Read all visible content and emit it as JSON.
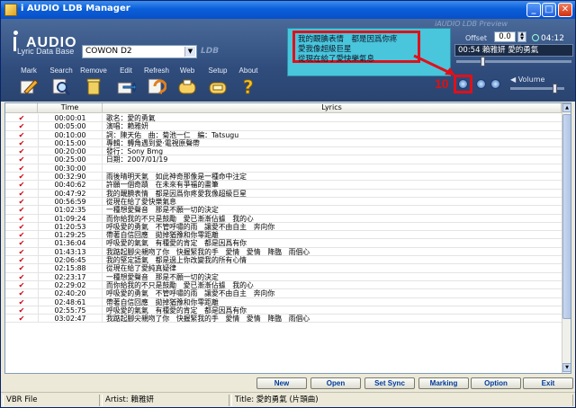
{
  "window": {
    "title": "i AUDIO LDB Manager"
  },
  "header": {
    "logo_text": "AUDIO",
    "db_label": "Lyric Data Base",
    "db_selected": "COWON D2",
    "db_tag": "LDB",
    "toolbar": [
      {
        "label": "Mark",
        "icon": "pencil-icon"
      },
      {
        "label": "Search",
        "icon": "search-icon"
      },
      {
        "label": "Remove",
        "icon": "trash-icon"
      },
      {
        "label": "Edit",
        "icon": "edit-icon"
      },
      {
        "label": "Refresh",
        "icon": "refresh-icon"
      },
      {
        "label": "Web",
        "icon": "web-icon"
      },
      {
        "label": "Setup",
        "icon": "setup-icon"
      },
      {
        "label": "About",
        "icon": "question-icon"
      }
    ]
  },
  "preview": {
    "title": "iAUDIO LDB Preview",
    "lines": [
      "我的靦腆表情　都是因爲你疼",
      "愛我像超級巨星",
      "從現在給了愛快樂氣息"
    ],
    "offset_label": "Offset",
    "offset_value": "0.0",
    "clock": "04:12",
    "position": "00:54",
    "now_title": "賴雅妍 愛的勇氣",
    "marker": "10",
    "volume_label": "Volume",
    "seek_fraction": 0.22,
    "volume_fraction": 0.85
  },
  "table": {
    "headers": {
      "mark": "",
      "time": "Time",
      "lyrics": "Lyrics"
    },
    "rows": [
      {
        "mark": "✔",
        "time": "00:00:01",
        "lyric": "歌名：愛的勇氣"
      },
      {
        "mark": "✔",
        "time": "00:05:00",
        "lyric": "演唱：賴雅妍"
      },
      {
        "mark": "✔",
        "time": "00:10:00",
        "lyric": "詞：陳天佑　曲：菊池一仁　編：Tatsugu"
      },
      {
        "mark": "✔",
        "time": "00:15:00",
        "lyric": "專輯：轉角遇到愛·電視原聲帶"
      },
      {
        "mark": "✔",
        "time": "00:20:00",
        "lyric": "發行：Sony Bmg"
      },
      {
        "mark": "✔",
        "time": "00:25:00",
        "lyric": "日期：2007/01/19"
      },
      {
        "mark": "✔",
        "time": "00:30:00",
        "lyric": ""
      },
      {
        "mark": "✔",
        "time": "00:32:90",
        "lyric": "雨後晴明天氣　如此神奇那像是一種命中注定"
      },
      {
        "mark": "✔",
        "time": "00:40:62",
        "lyric": "許願一個奇蹟　在未來有爭福的畫筆"
      },
      {
        "mark": "✔",
        "time": "00:47:92",
        "lyric": "我的靦腆表情　都是因爲你疼愛我像超級巨星"
      },
      {
        "mark": "✔",
        "time": "00:56:59",
        "lyric": "從現在給了愛快樂氣息"
      },
      {
        "mark": "✔",
        "time": "01:02:35",
        "lyric": "一種想愛聲音　那是不願一切的決定"
      },
      {
        "mark": "✔",
        "time": "01:09:24",
        "lyric": "而你給我的不只是鼓勵　愛已漸漸佔據　我的心"
      },
      {
        "mark": "✔",
        "time": "01:20:53",
        "lyric": "呼吸愛的勇氣　不管呼嘯的雨　讓愛不由自主　奔向你"
      },
      {
        "mark": "✔",
        "time": "01:29:25",
        "lyric": "帶著自信回應　拋掉猶豫和你零距離"
      },
      {
        "mark": "✔",
        "time": "01:36:04",
        "lyric": "呼吸愛的氣氣　有種愛的肯定　都是因爲有你"
      },
      {
        "mark": "✔",
        "time": "01:43:13",
        "lyric": "我踮起腳尖親吻了你　快握緊我的手　愛情　愛情　降臨　雨個心"
      },
      {
        "mark": "✔",
        "time": "02:06:45",
        "lyric": "我的堅定語氣　都是過上你改變我的所有心情"
      },
      {
        "mark": "✔",
        "time": "02:15:88",
        "lyric": "從現在給了愛純真疑律"
      },
      {
        "mark": "✔",
        "time": "02:23:17",
        "lyric": "一種想愛聲音　那是不願一切的決定"
      },
      {
        "mark": "✔",
        "time": "02:29:02",
        "lyric": "而你給我的不只是鼓勵　愛已漸漸佔據　我的心"
      },
      {
        "mark": "✔",
        "time": "02:40:20",
        "lyric": "呼吸愛的勇氣　不管呼嘯的雨　讓愛不由自主　奔向你"
      },
      {
        "mark": "✔",
        "time": "02:48:61",
        "lyric": "帶著自信回應　拋掉猶豫和你零距離"
      },
      {
        "mark": "✔",
        "time": "02:55:75",
        "lyric": "呼吸愛的氣氣　有種愛的肯定　都是因爲有你"
      },
      {
        "mark": "✔",
        "time": "03:02:47",
        "lyric": "我踮起腳尖親吻了你　快握緊我的手　愛情　愛情　降臨　雨個心"
      }
    ]
  },
  "buttons": {
    "new": "New",
    "open": "Open",
    "set_sync": "Set Sync",
    "marking": "Marking",
    "option": "Option",
    "exit": "Exit"
  },
  "status": {
    "file": "VBR File",
    "artist": "Artist: 賴雅妍",
    "title": "Title: 愛的勇氣 (片頭曲)"
  },
  "colors": {
    "highlight": "#e0101a",
    "preview_bg": "#49c5dc",
    "header_bg": "#2f4c7c"
  }
}
